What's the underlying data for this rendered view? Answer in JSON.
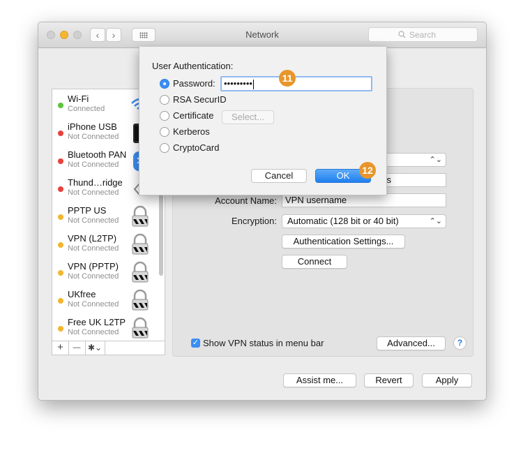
{
  "window": {
    "title": "Network",
    "search_placeholder": "Search",
    "search_icon": "magnifier-icon",
    "back_glyph": "‹",
    "forward_glyph": "›"
  },
  "sidebar": {
    "services": [
      {
        "name": "Wi-Fi",
        "status": "Connected",
        "status_color": "#5dc33a",
        "icon": "wifi-icon"
      },
      {
        "name": "iPhone USB",
        "status": "Not Connected",
        "status_color": "#e8413b",
        "icon": "iphone-icon"
      },
      {
        "name": "Bluetooth PAN",
        "status": "Not Connected",
        "status_color": "#e8413b",
        "icon": "bluetooth-icon"
      },
      {
        "name": "Thund…ridge",
        "status": "Not Connected",
        "status_color": "#e8413b",
        "icon": "thunderbolt-bridge-icon"
      },
      {
        "name": "PPTP US",
        "status": "Not Connected",
        "status_color": "#f4b52f",
        "icon": "vpn-lock-icon"
      },
      {
        "name": "VPN (L2TP)",
        "status": "Not Connected",
        "status_color": "#f4b52f",
        "icon": "vpn-lock-icon"
      },
      {
        "name": "VPN (PPTP)",
        "status": "Not Connected",
        "status_color": "#f4b52f",
        "icon": "vpn-lock-icon"
      },
      {
        "name": "UKfree",
        "status": "Not Connected",
        "status_color": "#f4b52f",
        "icon": "vpn-lock-icon"
      },
      {
        "name": "Free UK L2TP",
        "status": "Not Connected",
        "status_color": "#f4b52f",
        "icon": "vpn-lock-icon"
      }
    ],
    "tools": {
      "add": "+",
      "remove": "—",
      "action": "✱⌄"
    }
  },
  "detail": {
    "server_partial": "ss",
    "account_label": "Account Name:",
    "account_value": "VPN username",
    "encryption_label": "Encryption:",
    "encryption_value": "Automatic (128 bit or 40 bit)",
    "auth_settings_label": "Authentication Settings...",
    "connect_label": "Connect",
    "show_status_label": "Show VPN status in menu bar",
    "show_status_checked": true,
    "advanced_label": "Advanced...",
    "help_label": "?"
  },
  "footer": {
    "assist_label": "Assist me...",
    "revert_label": "Revert",
    "apply_label": "Apply"
  },
  "sheet": {
    "heading": "User Authentication:",
    "options": [
      {
        "label": "Password:",
        "selected": true
      },
      {
        "label": "RSA SecurID",
        "selected": false
      },
      {
        "label": "Certificate",
        "selected": false
      },
      {
        "label": "Kerberos",
        "selected": false
      },
      {
        "label": "CryptoCard",
        "selected": false
      }
    ],
    "password_value": "•••••••••",
    "select_label": "Select...",
    "cancel_label": "Cancel",
    "ok_label": "OK"
  },
  "annotations": {
    "step_password": "11",
    "step_ok": "12",
    "color": "#e8962b"
  }
}
